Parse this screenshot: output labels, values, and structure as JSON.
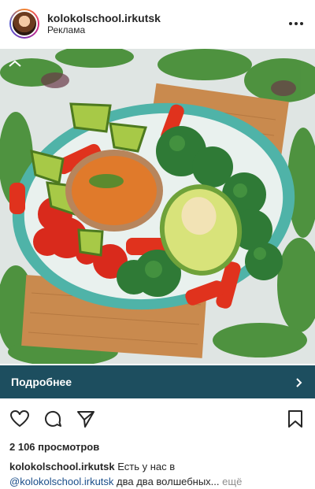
{
  "post": {
    "username": "kolokolschool.irkutsk",
    "sponsored_label": "Реклама",
    "more_icon": "more-horizontal-icon",
    "more_glyph": "•••"
  },
  "cta": {
    "label": "Подробнее",
    "arrow_icon": "chevron-right-icon",
    "bar_color": "#1d4e5f"
  },
  "actions": {
    "like_icon": "heart-icon",
    "comment_icon": "comment-icon",
    "share_icon": "send-icon",
    "save_icon": "bookmark-icon"
  },
  "stats": {
    "views": "2 106 просмотров"
  },
  "caption": {
    "author": "kolokolschool.irkutsk",
    "text1": " Есть у нас в",
    "mention": "@kolokolschool.irkutsk",
    "text2": " два два волшебных...",
    "more": " ещё"
  }
}
